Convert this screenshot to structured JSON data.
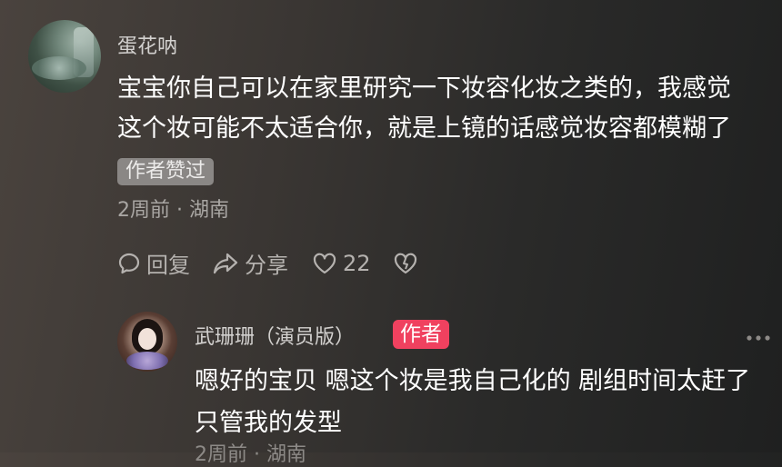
{
  "comment": {
    "username": "蛋花呐",
    "text_line1": "宝宝你自己可以在家里研究一下妆容化妆之类的，我感觉",
    "text_line2": "这个妆可能不太适合你，就是上镜的话感觉妆容都模糊了",
    "liked_badge": "作者赞过",
    "meta": "2周前 · 湖南",
    "actions": {
      "reply": "回复",
      "share": "分享",
      "like_count": "22"
    }
  },
  "reply": {
    "username": "武珊珊（演员版）",
    "author_badge": "作者",
    "text_line1": "嗯好的宝贝 嗯这个妆是我自己化的 剧组时间太赶了",
    "text_line2": "只管我的发型",
    "partial_meta": "2周前 · 湖南"
  },
  "colors": {
    "author_badge_bg": "#f0415f",
    "liked_badge_bg": "#8a8785"
  },
  "icons": [
    "comment-icon",
    "share-icon",
    "heart-icon",
    "dislike-heart-icon",
    "more-icon"
  ]
}
